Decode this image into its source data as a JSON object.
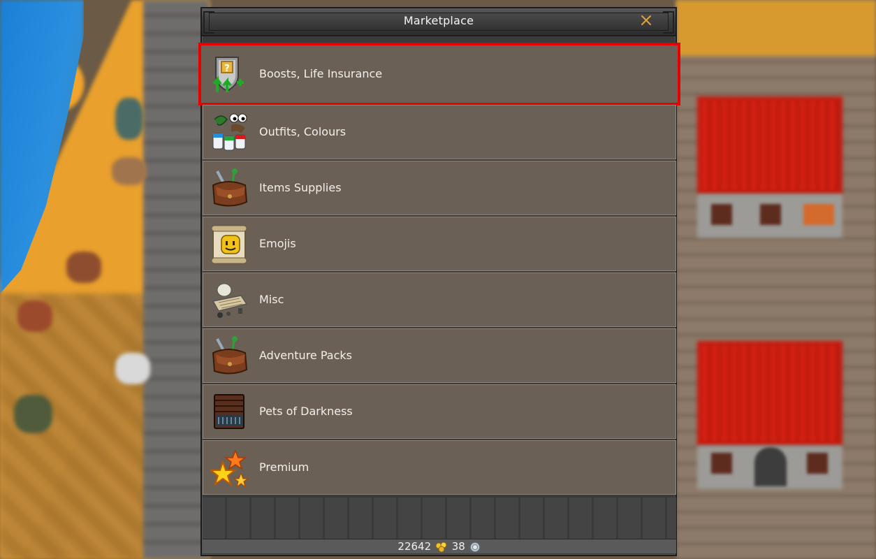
{
  "window": {
    "title": "Marketplace",
    "close_icon": "close-x-icon"
  },
  "categories": [
    {
      "label": "Boosts, Life Insurance",
      "icon": "boost-shield-icon",
      "selected": true
    },
    {
      "label": "Outfits, Colours",
      "icon": "outfit-paint-icon",
      "selected": false
    },
    {
      "label": "Items Supplies",
      "icon": "leather-bag-icon",
      "selected": false
    },
    {
      "label": "Emojis",
      "icon": "emoji-scroll-icon",
      "selected": false
    },
    {
      "label": "Misc",
      "icon": "misc-scroll-icon",
      "selected": false
    },
    {
      "label": "Adventure Packs",
      "icon": "adventure-bag-icon",
      "selected": false
    },
    {
      "label": "Pets of Darkness",
      "icon": "dark-chest-icon",
      "selected": false
    },
    {
      "label": "Premium",
      "icon": "premium-star-icon",
      "selected": false
    }
  ],
  "footer": {
    "gold": "22642",
    "gold_icon": "gold-coins-icon",
    "silver": "38",
    "silver_icon": "silver-coin-icon"
  },
  "colors": {
    "selected_outline": "#e60000",
    "accent_close": "#e0a33a"
  }
}
